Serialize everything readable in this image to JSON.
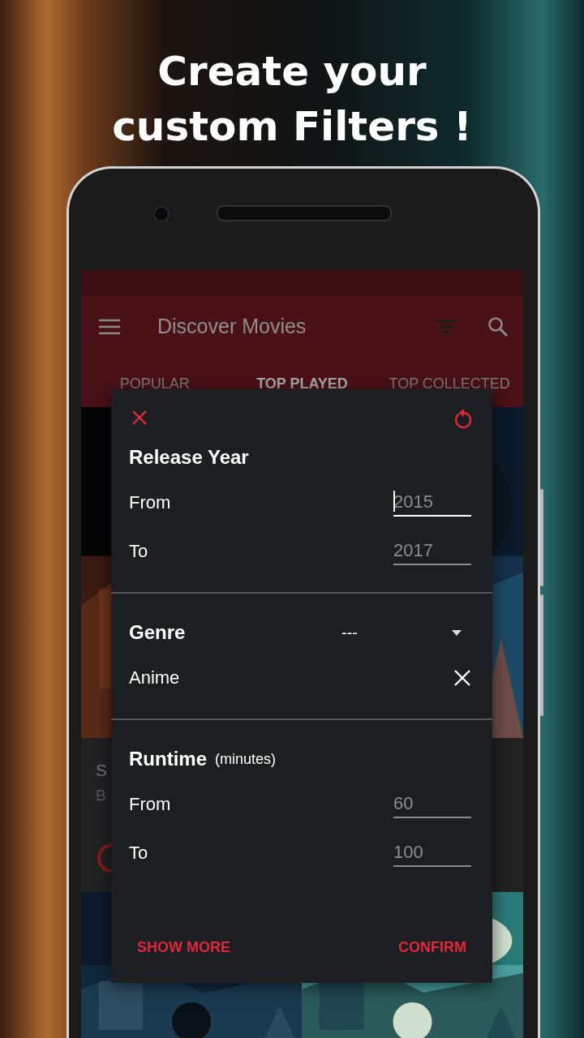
{
  "headline": [
    "Create your",
    "custom Filters !"
  ],
  "app_bar": {
    "title": "Discover Movies"
  },
  "tabs": [
    {
      "label": "POPULAR",
      "selected": false
    },
    {
      "label": "TOP PLAYED",
      "selected": true
    },
    {
      "label": "TOP COLLECTED",
      "selected": false
    }
  ],
  "movie_card": {
    "title": "S",
    "subtitle": "B"
  },
  "filter_dialog": {
    "sections": [
      {
        "kind": "range",
        "title": "Release Year",
        "fields": [
          {
            "label": "From",
            "placeholder": "2015",
            "focused": true
          },
          {
            "label": "To",
            "placeholder": "2017",
            "focused": false
          }
        ]
      },
      {
        "kind": "choice",
        "title": "Genre",
        "spinner": {
          "value": "---"
        },
        "chips": [
          {
            "label": "Anime"
          }
        ]
      },
      {
        "kind": "range",
        "title": "Runtime",
        "unit": "(minutes)",
        "fields": [
          {
            "label": "From",
            "placeholder": "60",
            "focused": false
          },
          {
            "label": "To",
            "placeholder": "100",
            "focused": false
          }
        ]
      }
    ],
    "buttons": [
      {
        "label": "SHOW MORE"
      },
      {
        "label": "CONFIRM"
      }
    ]
  }
}
